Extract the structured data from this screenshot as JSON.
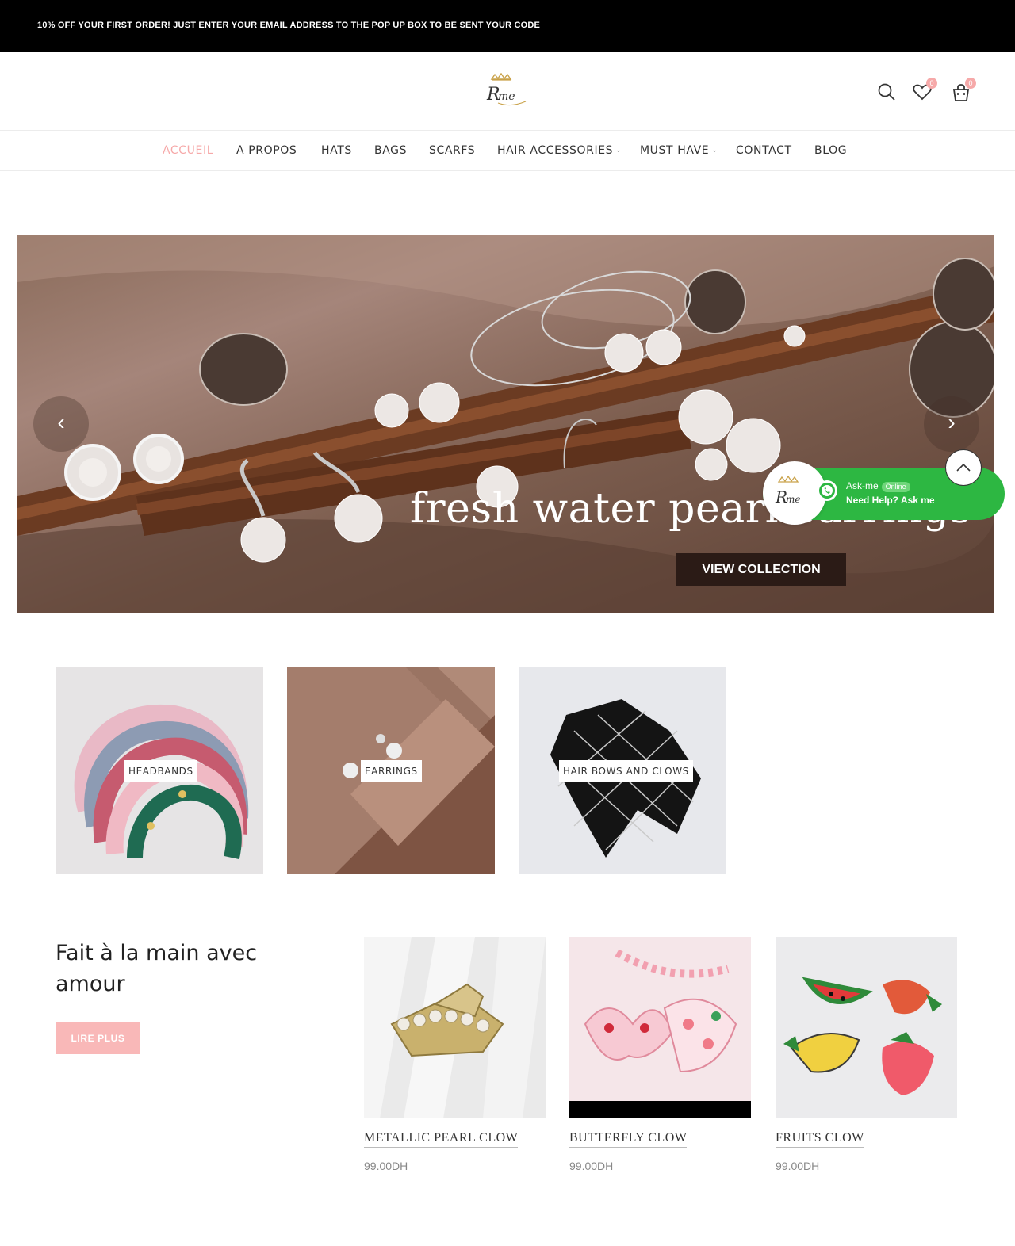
{
  "announcement": "10% OFF YOUR FIRST ORDER! JUST ENTER YOUR EMAIL ADDRESS TO THE POP UP BOX TO BE SENT YOUR CODE",
  "header": {
    "logo_text": "Rme",
    "wishlist_count": "0",
    "cart_count": "0"
  },
  "nav": [
    {
      "label": "ACCUEIL"
    },
    {
      "label": "A PROPOS"
    },
    {
      "label": "HATS"
    },
    {
      "label": "BAGS"
    },
    {
      "label": "SCARFS"
    },
    {
      "label": "HAIR ACCESSORIES"
    },
    {
      "label": "MUST HAVE"
    },
    {
      "label": "CONTACT"
    },
    {
      "label": "BLOG"
    }
  ],
  "hero": {
    "title": "fresh water pearl earrings",
    "button": "VIEW COLLECTION",
    "prev_arrow": "‹",
    "next_arrow": "›"
  },
  "whatsapp": {
    "line1": "Ask-me",
    "status": "Online",
    "line2": "Need Help? Ask me"
  },
  "categories": [
    {
      "label": "HEADBANDS"
    },
    {
      "label": "EARRINGS"
    },
    {
      "label": "HAIR BOWS AND CLOWS"
    }
  ],
  "feature": {
    "title": "Fait à la main avec amour",
    "button": "LIRE PLUS"
  },
  "products": [
    {
      "name": "METALLIC PEARL CLOW",
      "price": "99.00DH"
    },
    {
      "name": "BUTTERFLY CLOW",
      "price": "99.00DH"
    },
    {
      "name": "FRUITS CLOW",
      "price": "99.00DH"
    }
  ],
  "colors": {
    "accent_pink": "#f6a9a9",
    "whatsapp_green": "#2db742",
    "topbar": "#000000"
  }
}
